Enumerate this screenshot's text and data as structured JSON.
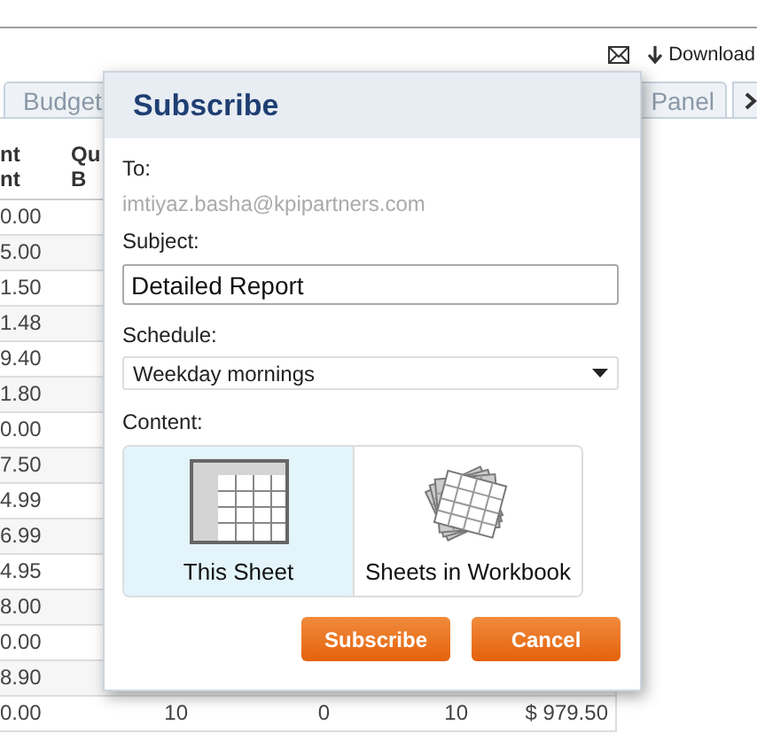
{
  "toolbar": {
    "download": "Download"
  },
  "tabs": [
    {
      "label": "Budget",
      "selected": false
    },
    {
      "label": "Panel",
      "selected": false
    }
  ],
  "table": {
    "columns": [
      {
        "line_1": "nt",
        "line_2": "nt"
      },
      {
        "line_1": "Qu",
        "line_2": "B"
      }
    ],
    "rows": [
      {
        "cells": [
          "0.00"
        ]
      },
      {
        "cells": [
          "5.00"
        ]
      },
      {
        "cells": [
          "1.50"
        ]
      },
      {
        "cells": [
          "1.48"
        ]
      },
      {
        "cells": [
          "9.40"
        ]
      },
      {
        "cells": [
          "1.80"
        ]
      },
      {
        "cells": [
          "0.00"
        ]
      },
      {
        "cells": [
          "7.50"
        ]
      },
      {
        "cells": [
          "4.99"
        ]
      },
      {
        "cells": [
          "6.99"
        ]
      },
      {
        "cells": [
          "4.95"
        ]
      },
      {
        "cells": [
          "8.00"
        ]
      },
      {
        "cells": [
          "0.00"
        ]
      },
      {
        "cells": [
          "8.90"
        ]
      },
      {
        "cells": [
          "0.00",
          "10",
          "0",
          "10",
          "$ 979.50"
        ]
      }
    ]
  },
  "dialog": {
    "title": "Subscribe",
    "to_label": "To:",
    "to": "imtiyaz.basha@kpipartners.com",
    "subject_label": "Subject:",
    "subject": "Detailed Report",
    "schedule_label": "Schedule:",
    "schedule": "Weekday mornings",
    "content_label": "Content:",
    "content_options": [
      {
        "label": "This Sheet",
        "selected": true,
        "kind": "sheet"
      },
      {
        "label": "Sheets in Workbook",
        "selected": false,
        "kind": "workbook"
      }
    ],
    "buttons": [
      "Subscribe",
      "Cancel"
    ]
  }
}
